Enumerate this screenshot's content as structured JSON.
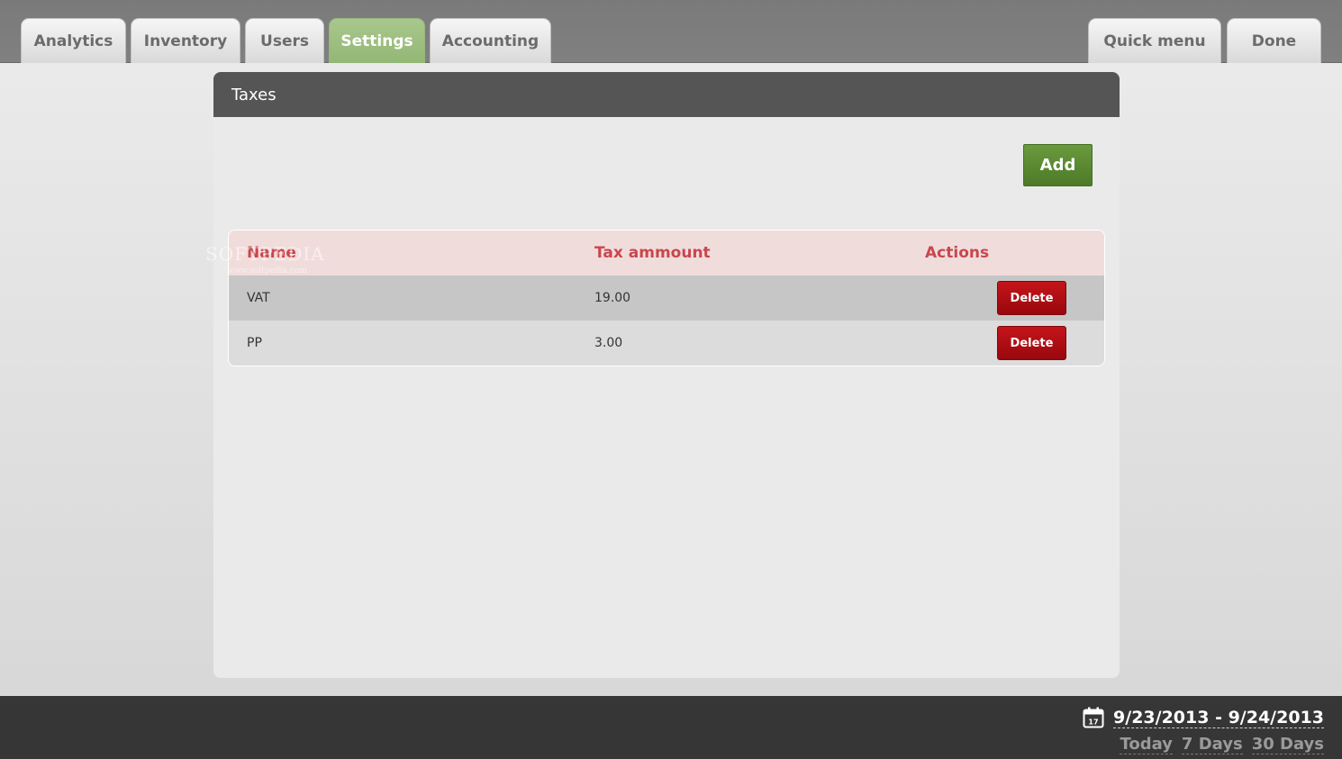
{
  "nav": {
    "tabs": [
      {
        "label": "Analytics",
        "active": false
      },
      {
        "label": "Inventory",
        "active": false
      },
      {
        "label": "Users",
        "active": false
      },
      {
        "label": "Settings",
        "active": true
      },
      {
        "label": "Accounting",
        "active": false
      }
    ],
    "quick_menu_label": "Quick menu",
    "done_label": "Done"
  },
  "panel": {
    "title": "Taxes",
    "add_label": "Add",
    "table": {
      "headers": [
        "Name",
        "Tax ammount",
        "Actions"
      ],
      "rows": [
        {
          "name": "VAT",
          "amount": "19.00",
          "action": "Delete"
        },
        {
          "name": "PP",
          "amount": "3.00",
          "action": "Delete"
        }
      ]
    }
  },
  "footer": {
    "date_range": "9/23/2013 - 9/24/2013",
    "calendar_day": "17",
    "quick_ranges": [
      "Today",
      "7 Days",
      "30 Days"
    ]
  },
  "watermark": {
    "text": "SOFTPEDIA",
    "url": "www.softpedia.com"
  },
  "colors": {
    "active_tab": "#9bbd7e",
    "add_button": "#5a8a32",
    "delete_button": "#b00e13",
    "header_text": "#c8474d"
  }
}
